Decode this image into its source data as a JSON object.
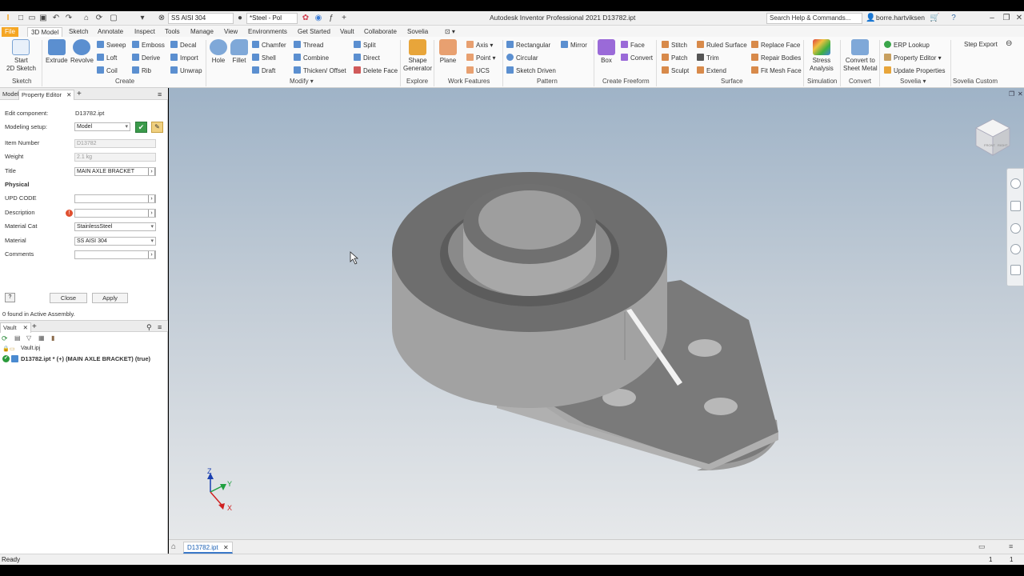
{
  "app": {
    "window_title": "Autodesk Inventor Professional 2021   D13782.ipt",
    "material_combo": "SS AISI 304",
    "appearance_combo": "*Steel - Pol",
    "search_placeholder": "Search Help & Commands...",
    "user": "borre.hartviksen",
    "quick_access_icons": [
      "new-icon",
      "open-icon",
      "save-icon",
      "undo-icon",
      "redo-icon",
      "home-icon",
      "update-icon",
      "select-icon"
    ]
  },
  "menu": {
    "tabs": [
      "File",
      "3D Model",
      "Sketch",
      "Annotate",
      "Inspect",
      "Tools",
      "Manage",
      "View",
      "Environments",
      "Get Started",
      "Vault",
      "Collaborate",
      "Sovelia"
    ],
    "active": "3D Model"
  },
  "ribbon": {
    "sketch": {
      "start_sketch": "Start\n2D Sketch",
      "group": "Sketch"
    },
    "create": {
      "extrude": "Extrude",
      "revolve": "Revolve",
      "sweep": "Sweep",
      "loft": "Loft",
      "coil": "Coil",
      "emboss": "Emboss",
      "derive": "Derive",
      "rib": "Rib",
      "decal": "Decal",
      "import": "Import",
      "unwrap": "Unwrap",
      "group": "Create"
    },
    "modify": {
      "hole": "Hole",
      "fillet": "Fillet",
      "chamfer": "Chamfer",
      "shell": "Shell",
      "draft": "Draft",
      "thread": "Thread",
      "combine": "Combine",
      "thicken": "Thicken/ Offset",
      "split": "Split",
      "direct": "Direct",
      "delete_face": "Delete Face",
      "group": "Modify ▾"
    },
    "explore": {
      "shape_generator": "Shape\nGenerator",
      "group": "Explore"
    },
    "work_features": {
      "plane": "Plane",
      "axis": "Axis ▾",
      "point": "Point ▾",
      "ucs": "UCS",
      "group": "Work Features"
    },
    "pattern": {
      "rectangular": "Rectangular",
      "circular": "Circular",
      "sketch_driven": "Sketch Driven",
      "mirror": "Mirror",
      "group": "Pattern"
    },
    "freeform": {
      "box": "Box",
      "face": "Face",
      "convert": "Convert",
      "group": "Create Freeform"
    },
    "surface": {
      "stitch": "Stitch",
      "patch": "Patch",
      "sculpt": "Sculpt",
      "ruled_surface": "Ruled Surface",
      "trim": "Trim",
      "extend": "Extend",
      "replace_face": "Replace Face",
      "repair_bodies": "Repair Bodies",
      "fit_mesh_face": "Fit Mesh Face",
      "group": "Surface"
    },
    "simulation": {
      "stress_analysis": "Stress\nAnalysis",
      "group": "Simulation"
    },
    "convert": {
      "sheet_metal": "Convert to\nSheet Metal",
      "group": "Convert"
    },
    "sovelia": {
      "erp_lookup": "ERP Lookup",
      "property_editor": "Property Editor ▾",
      "update_properties": "Update Properties",
      "group": "Sovelia ▾"
    },
    "sovelia_custom": {
      "step_export": "Step Export",
      "group": "Sovelia Custom"
    }
  },
  "panel": {
    "tabs": [
      "Model",
      "Property Editor"
    ],
    "edit_component_label": "Edit component:",
    "edit_component_value": "D13782.ipt",
    "modeling_setup_label": "Modeling setup:",
    "modeling_setup_value": "Model",
    "fields": [
      {
        "label": "Item Number",
        "value": "D13782",
        "disabled": true
      },
      {
        "label": "Weight",
        "value": "2.1 kg",
        "disabled": true
      },
      {
        "label": "Title",
        "value": "MAIN AXLE BRACKET",
        "disabled": false
      }
    ],
    "section_physical": "Physical",
    "physical_fields": [
      {
        "label": "UPD CODE",
        "value": ""
      },
      {
        "label": "Description",
        "value": ""
      },
      {
        "label": "Material Cat",
        "value": "StainlessSteel"
      },
      {
        "label": "Material",
        "value": "SS AISI 304"
      },
      {
        "label": "Comments",
        "value": ""
      }
    ],
    "close_button": "Close",
    "apply_button": "Apply",
    "found_text": "0 found in Active Assembly.",
    "vault_tab": "Vault",
    "vault_root": "Vault.ipj",
    "vault_item": "D13782.ipt * (+) (MAIN AXLE BRACKET) (true)"
  },
  "document_tab": "D13782.ipt",
  "status": {
    "left": "Ready",
    "right_count_1": "1",
    "right_count_2": "1"
  },
  "viewcube": {
    "front": "FRONT",
    "right": "RIGHT"
  },
  "triad": {
    "x": "X",
    "y": "Y",
    "z": "Z"
  },
  "colors": {
    "accent": "#f5a623",
    "part": "#8c8c8c",
    "link": "#1a5fb4"
  }
}
